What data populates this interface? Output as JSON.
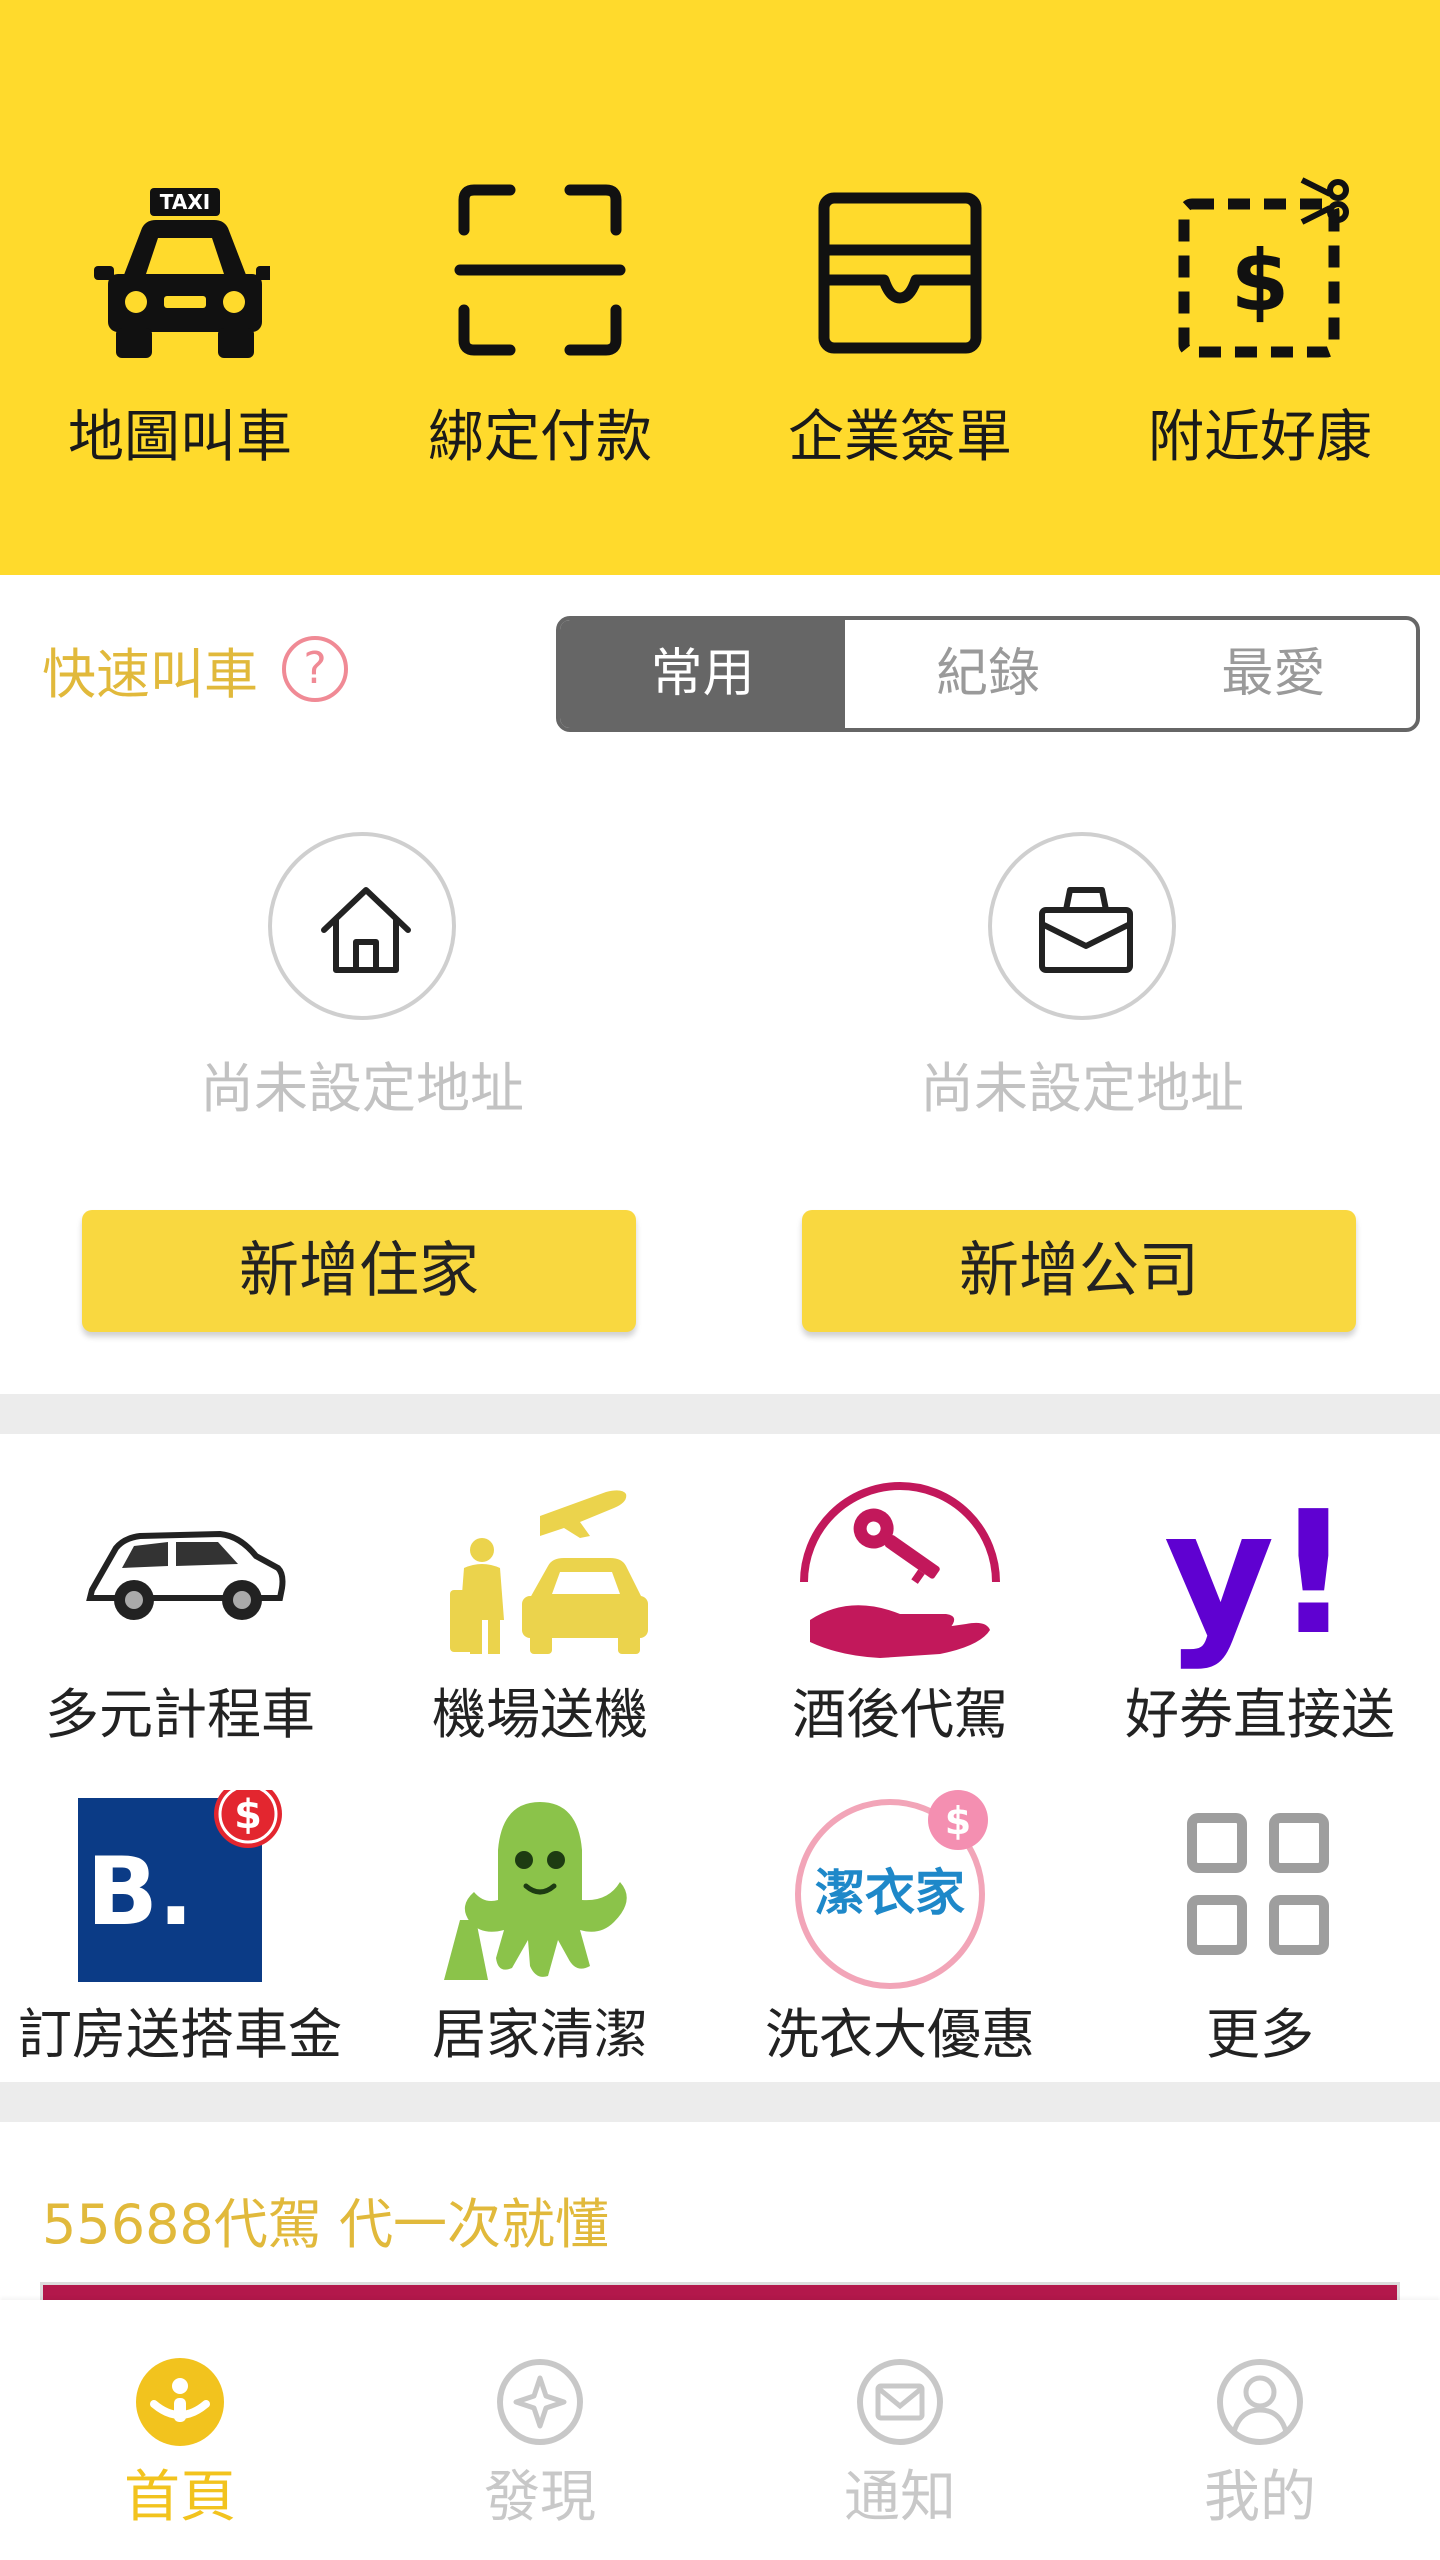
{
  "colors": {
    "brand_yellow": "#FFDA2C",
    "accent_gold": "#E1B93B",
    "segment_active": "#666666",
    "button_yellow": "#F9D840",
    "help_pink": "#F08A95"
  },
  "top_actions": [
    {
      "label": "地圖叫車",
      "icon": "taxi-icon",
      "badge_text": "TAXI"
    },
    {
      "label": "綁定付款",
      "icon": "scan-frame-icon"
    },
    {
      "label": "企業簽單",
      "icon": "wallet-icon"
    },
    {
      "label": "附近好康",
      "icon": "coupon-icon",
      "symbol": "$"
    }
  ],
  "quick_call": {
    "title": "快速叫車",
    "help_symbol": "?",
    "tabs": [
      "常用",
      "紀錄",
      "最愛"
    ],
    "active_tab": "常用",
    "home": {
      "note": "尚未設定地址",
      "button": "新增住家",
      "icon": "home-icon"
    },
    "company": {
      "note": "尚未設定地址",
      "button": "新增公司",
      "icon": "briefcase-icon"
    }
  },
  "services": [
    {
      "label": "多元計程車",
      "icon": "suv-car-icon"
    },
    {
      "label": "機場送機",
      "icon": "airport-transfer-icon"
    },
    {
      "label": "酒後代駕",
      "icon": "designated-driver-icon"
    },
    {
      "label": "好券直接送",
      "icon": "yahoo-icon",
      "logo_text": "y!"
    },
    {
      "label": "訂房送搭車金",
      "icon": "booking-icon",
      "logo_text": "B.",
      "badge": "$"
    },
    {
      "label": "居家清潔",
      "icon": "cleaning-octopus-icon"
    },
    {
      "label": "洗衣大優惠",
      "icon": "laundry-icon",
      "logo_text": "潔衣家",
      "badge": "$"
    },
    {
      "label": "更多",
      "icon": "grid-more-icon"
    }
  ],
  "promo": {
    "title": "55688代駕 代一次就懂"
  },
  "bottom_nav": [
    {
      "label": "首頁",
      "icon": "home-logo-icon",
      "active": true
    },
    {
      "label": "發現",
      "icon": "discover-icon",
      "active": false
    },
    {
      "label": "通知",
      "icon": "mail-icon",
      "active": false
    },
    {
      "label": "我的",
      "icon": "profile-icon",
      "active": false
    }
  ]
}
